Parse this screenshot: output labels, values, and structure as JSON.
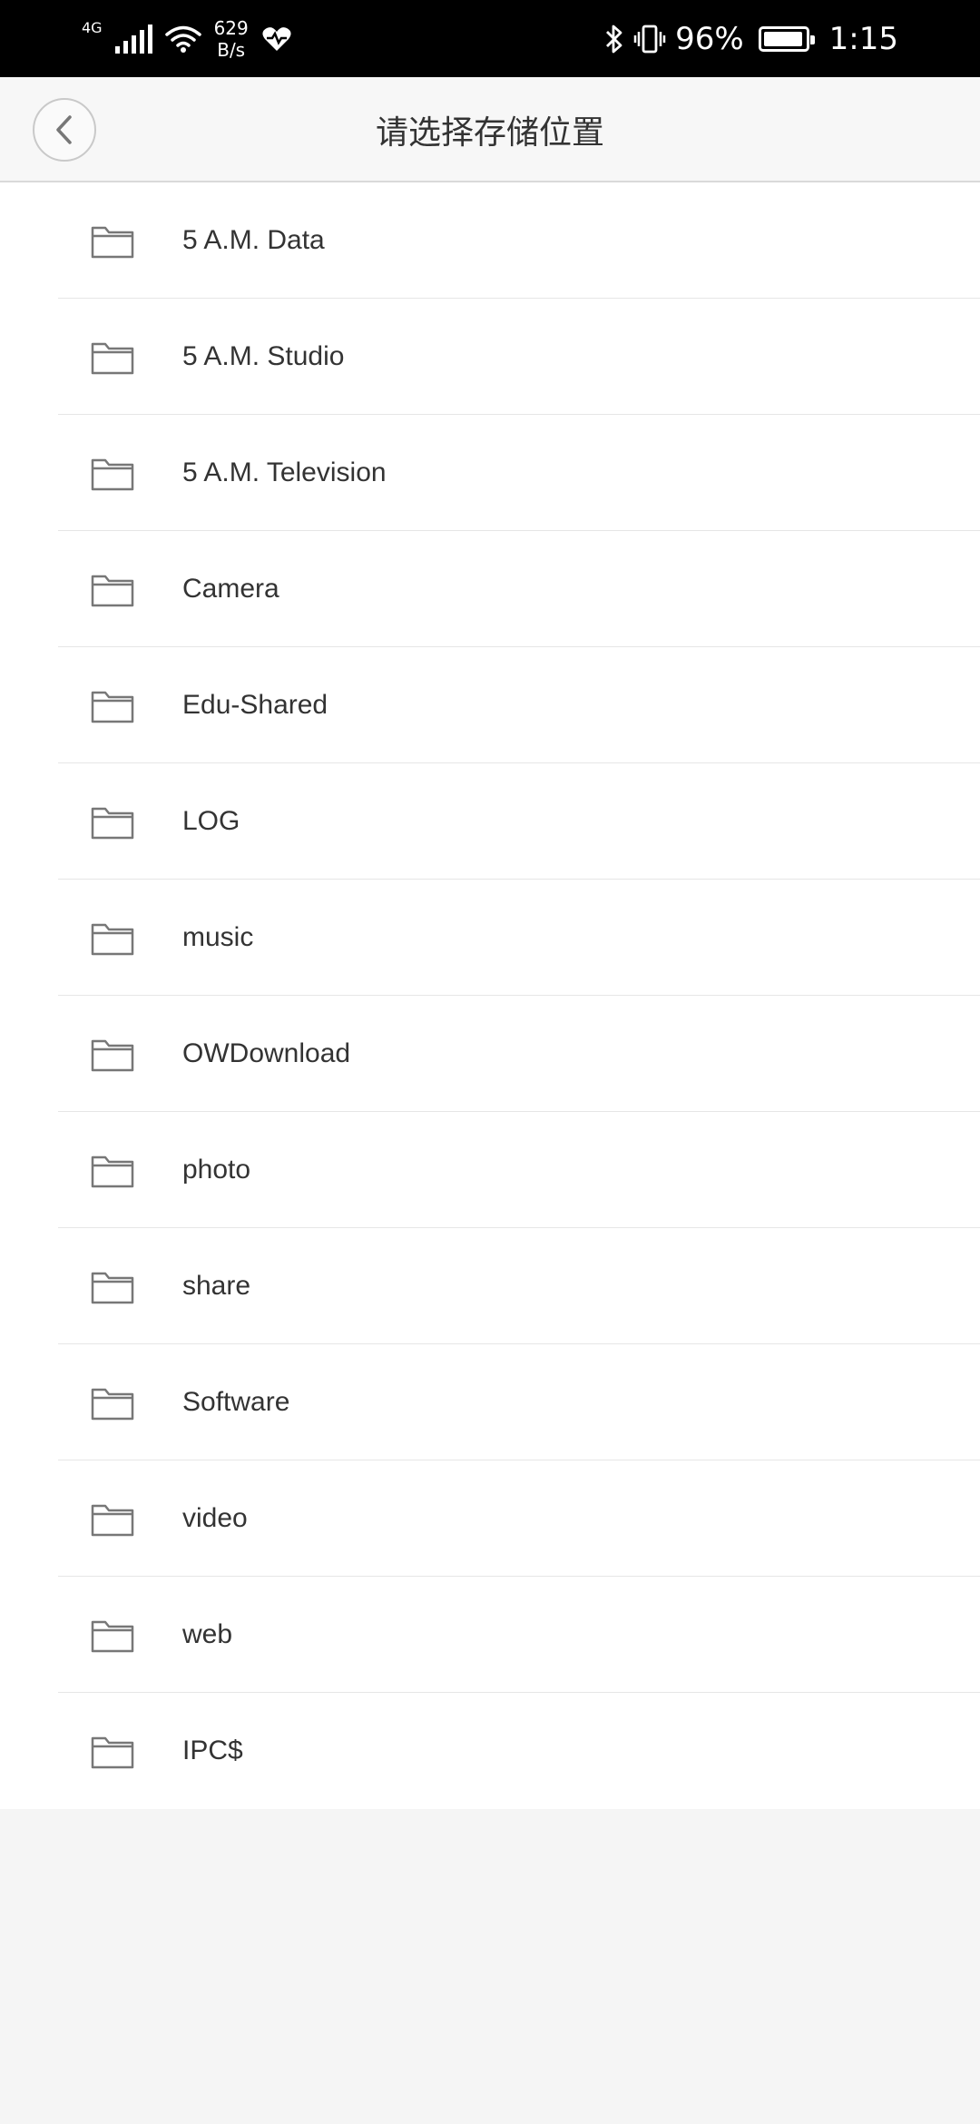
{
  "status_bar": {
    "network_type": "4G",
    "net_speed_value": "629",
    "net_speed_unit": "B/s",
    "battery_percent": "96%",
    "battery_level": 0.96,
    "time": "1:15",
    "icons": [
      "signal-icon",
      "wifi-icon",
      "health-heart-icon",
      "bluetooth-icon",
      "vibrate-icon",
      "battery-icon"
    ]
  },
  "header": {
    "title": "请选择存储位置",
    "back_icon": "chevron-left-icon"
  },
  "folders": [
    {
      "label": "5 A.M. Data"
    },
    {
      "label": "5 A.M. Studio"
    },
    {
      "label": "5 A.M. Television"
    },
    {
      "label": "Camera"
    },
    {
      "label": "Edu-Shared"
    },
    {
      "label": "LOG"
    },
    {
      "label": "music"
    },
    {
      "label": "OWDownload"
    },
    {
      "label": "photo"
    },
    {
      "label": "share"
    },
    {
      "label": "Software"
    },
    {
      "label": "video"
    },
    {
      "label": "web"
    },
    {
      "label": "IPC$"
    }
  ],
  "colors": {
    "status_bar_bg": "#000000",
    "header_bg": "#f7f7f7",
    "list_bg": "#ffffff",
    "page_bg": "#f5f5f5",
    "text": "#333333",
    "icon_stroke": "#777777"
  }
}
